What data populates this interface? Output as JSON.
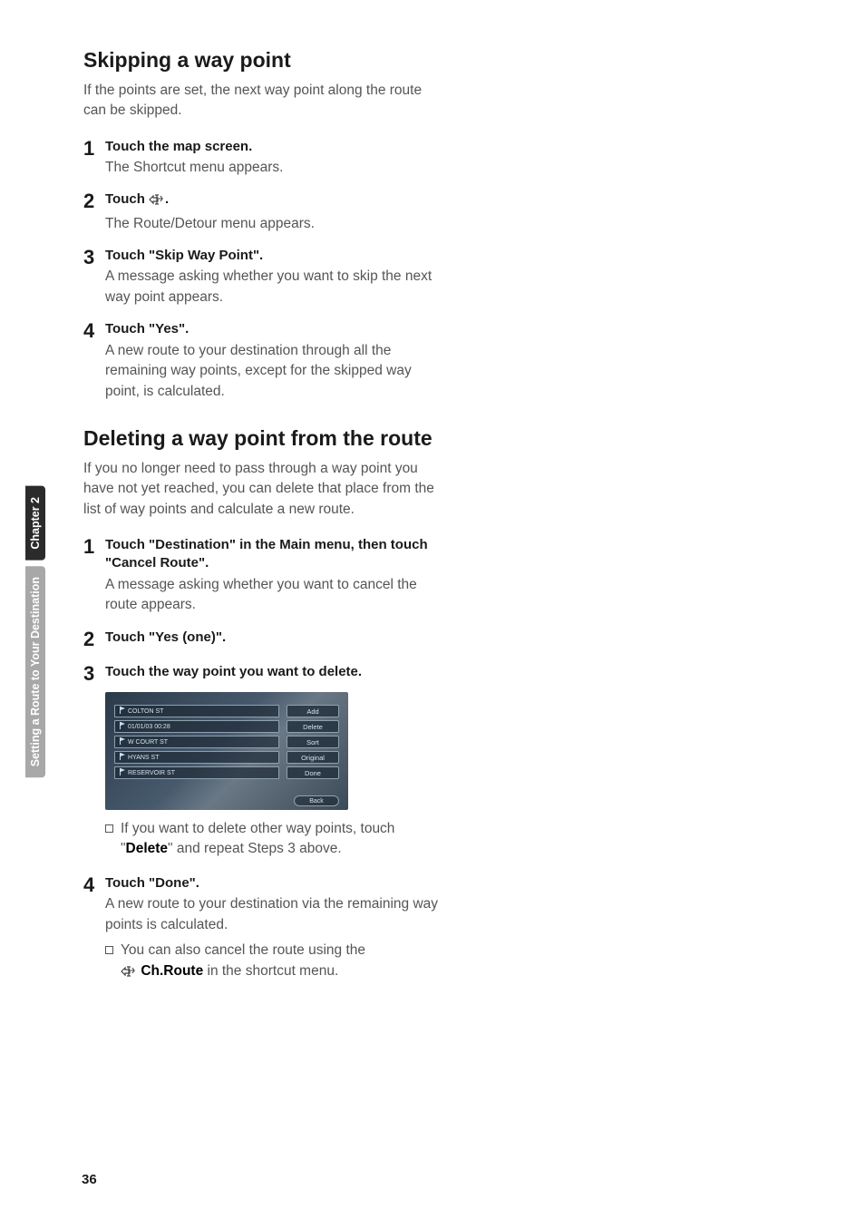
{
  "side": {
    "chapter": "Chapter 2",
    "running": "Setting a Route to Your Destination"
  },
  "pagenum": "36",
  "sec1": {
    "title": "Skipping a way point",
    "intro": "If the points are set, the next way point along the route can be skipped.",
    "steps": [
      {
        "n": "1",
        "t": "Touch the map screen.",
        "d": "The Shortcut menu appears."
      },
      {
        "n": "2",
        "t_pre": "Touch ",
        "t_post": ".",
        "d": "The Route/Detour menu appears."
      },
      {
        "n": "3",
        "t": "Touch \"Skip Way Point\".",
        "d": "A message asking whether you want to skip the next way point appears."
      },
      {
        "n": "4",
        "t": "Touch \"Yes\".",
        "d": "A new route to your destination through all the remaining way points, except for the skipped way point, is calculated."
      }
    ]
  },
  "sec2": {
    "title": "Deleting a way point from the route",
    "intro": "If you no longer need to pass through a way point you have not yet reached, you can delete that place from the list of way points and calculate a new route.",
    "steps": [
      {
        "n": "1",
        "t": "Touch \"Destination\" in the Main menu, then touch \"Cancel Route\".",
        "d": "A message asking whether you want to cancel the route appears."
      },
      {
        "n": "2",
        "t": "Touch \"Yes (one)\"."
      },
      {
        "n": "3",
        "t": "Touch the way point you want to delete."
      },
      {
        "n": "4",
        "t": "Touch \"Done\".",
        "d": "A new route to your destination via the remaining way points is calculated."
      }
    ],
    "bullet3_pre": "If you want to delete other way points, touch \"",
    "bullet3_bold": "Delete",
    "bullet3_post": "\" and repeat Steps 3 above.",
    "bullet4a": "You can also cancel the route using the",
    "bullet4b_bold": "Ch.Route",
    "bullet4b_post": " in the shortcut menu."
  },
  "shot": {
    "items": [
      "COLTON ST",
      "01/01/03 00:28",
      "W COURT ST",
      "HYANS ST",
      "RESERVOIR ST"
    ],
    "btns": [
      "Add",
      "Delete",
      "Sort",
      "Original",
      "Done"
    ],
    "back": "Back"
  }
}
